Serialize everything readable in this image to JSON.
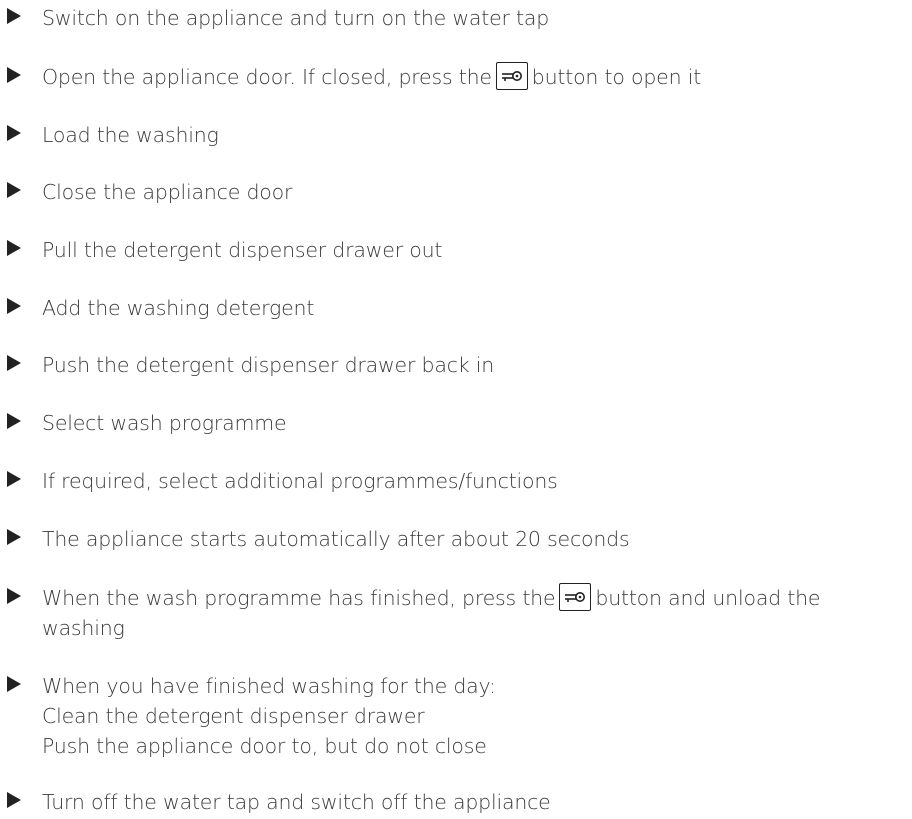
{
  "icons": {
    "bullet": "right-pointing-triangle-icon",
    "door_button": "key-icon"
  },
  "steps": [
    {
      "text": "Switch on the appliance and turn on the water tap"
    },
    {
      "before": "Open the appliance door. If closed, press the",
      "after": "button to open it"
    },
    {
      "text": "Load the washing"
    },
    {
      "text": "Close the appliance door"
    },
    {
      "text": "Pull the detergent dispenser drawer out"
    },
    {
      "text": "Add the washing detergent"
    },
    {
      "text": "Push the detergent dispenser drawer back in"
    },
    {
      "text": "Select wash programme"
    },
    {
      "text": "If required, select additional programmes/functions"
    },
    {
      "text": "The appliance starts automatically after about 20 seconds"
    },
    {
      "before": "When the wash programme has finished, press the",
      "after": "button and unload the",
      "line2": "washing"
    },
    {
      "line1": "When you have finished washing for the day:",
      "line2": "Clean the detergent dispenser drawer",
      "line3": "Push the appliance door to, but do not close"
    },
    {
      "text": "Turn off the water tap and switch off the appliance"
    }
  ]
}
